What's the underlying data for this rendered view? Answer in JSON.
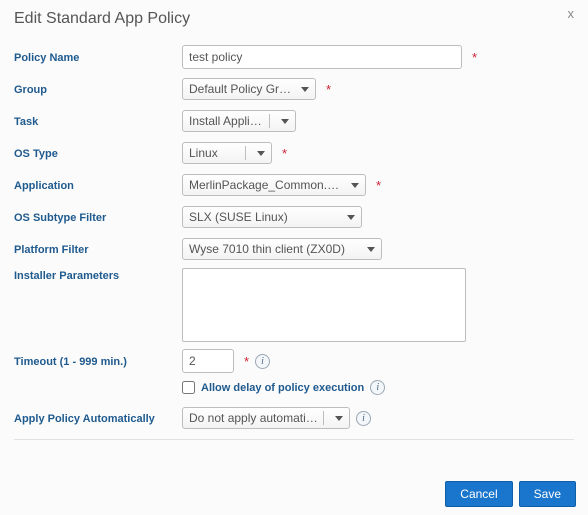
{
  "dialog": {
    "title": "Edit Standard App Policy",
    "close": "x"
  },
  "labels": {
    "policyName": "Policy Name",
    "group": "Group",
    "task": "Task",
    "osType": "OS Type",
    "application": "Application",
    "osSubtypeFilter": "OS Subtype Filter",
    "platformFilter": "Platform Filter",
    "installerParams": "Installer Parameters",
    "timeout": "Timeout (1 - 999 min.)",
    "allowDelay": "Allow delay of policy execution",
    "applyAuto": "Apply Policy Automatically"
  },
  "values": {
    "policyName": "test policy",
    "group": "Default Policy Group",
    "task": "Install Application",
    "osType": "Linux",
    "application": "MerlinPackage_Common.exe (Loc",
    "osSubtypeFilter": "SLX (SUSE Linux)",
    "platformFilter": "Wyse 7010 thin client (ZX0D)",
    "installerParams": "",
    "timeout": "2",
    "allowDelay": false,
    "applyAuto": "Do not apply automatically"
  },
  "required": {
    "policyName": true,
    "group": true,
    "osType": true,
    "application": true,
    "timeout": true
  },
  "footer": {
    "cancel": "Cancel",
    "save": "Save"
  }
}
